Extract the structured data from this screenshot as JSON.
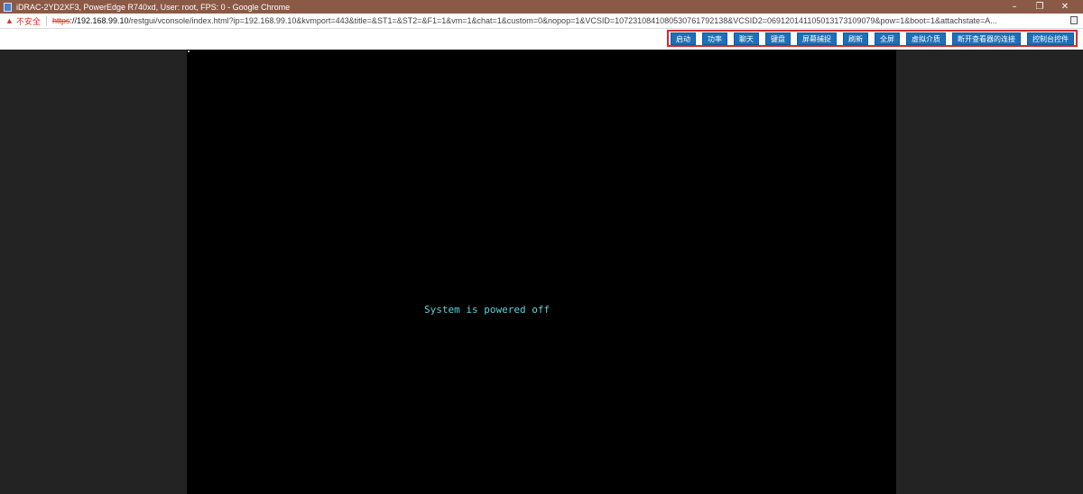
{
  "window": {
    "title": "iDRAC-2YD2XF3, PowerEdge R740xd, User: root, FPS: 0 - Google Chrome",
    "controls": {
      "minimize": "–",
      "restore": "❐",
      "close": "✕"
    }
  },
  "address_bar": {
    "security_label": "不安全",
    "url_scheme": "https",
    "url_host": "://192.168.99.10",
    "url_rest": "/restgui/vconsole/index.html?ip=192.168.99.10&kvmport=443&title=&ST1=&ST2=&F1=1&vm=1&chat=1&custom=0&nopop=1&VCSID=1072310841080530761792138&VCSID2=069120141105013173109079&pow=1&boot=1&attachstate=A..."
  },
  "toolbar": {
    "buttons": [
      "启动",
      "功率",
      "聊天",
      "键盘",
      "屏幕捕捉",
      "刷新",
      "全屏",
      "虚拟介质",
      "断开查看器的连接",
      "控制台控件"
    ]
  },
  "console": {
    "message": "System is powered off"
  },
  "colors": {
    "titlebar": "#8b5a46",
    "button": "#1e6fb8",
    "highlight_border": "#d32a2a",
    "console_text": "#5fd3d8"
  }
}
